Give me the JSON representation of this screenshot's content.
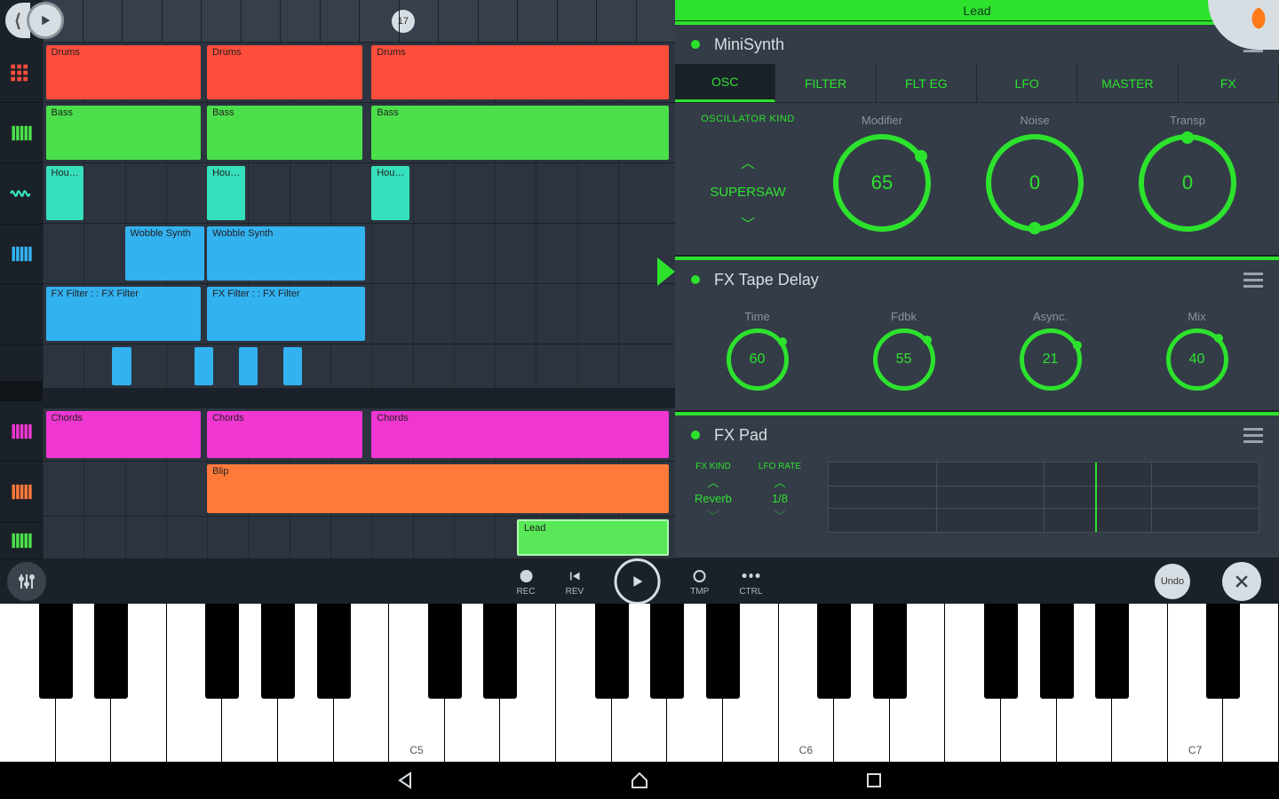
{
  "colors": {
    "accent_green": "#2de22d",
    "panel": "#343c48",
    "panel_dark": "#1b2129"
  },
  "playlist": {
    "playhead_bar": "17",
    "tracks": [
      {
        "color": "red",
        "icon": "pads",
        "clips": [
          "Drums",
          "Drums",
          "Drums"
        ]
      },
      {
        "color": "green",
        "icon": "piano",
        "clips": [
          "Bass",
          "Bass",
          "Bass"
        ]
      },
      {
        "color": "teal",
        "icon": "wave",
        "clips": [
          "Hou…",
          "Hou…",
          "Hou…"
        ]
      },
      {
        "color": "blue",
        "icon": "piano",
        "clips": [
          "Wobble Synth",
          "Wobble Synth"
        ]
      },
      {
        "color": "blue",
        "icon": "",
        "clips": [
          "FX Filter :  : FX Filter",
          "FX Filter :  : FX Filter"
        ]
      },
      {
        "color": "blue",
        "icon": "",
        "clips": [
          "",
          "",
          "",
          ""
        ]
      },
      {
        "color": "magenta",
        "icon": "piano",
        "clips": [
          "Chords",
          "Chords",
          "Chords"
        ]
      },
      {
        "color": "orange",
        "icon": "piano",
        "clips": [
          "Blip"
        ]
      },
      {
        "color": "green",
        "icon": "piano",
        "clips": [
          "Lead"
        ]
      }
    ]
  },
  "rack": {
    "title": "Lead",
    "modules": {
      "synth": {
        "name": "MiniSynth",
        "tabs": [
          "OSC",
          "FILTER",
          "FLT EG",
          "LFO",
          "MASTER",
          "FX"
        ],
        "active_tab": 0,
        "osc_kind_label": "OSCILLATOR KIND",
        "osc_kind_value": "SUPERSAW",
        "knobs": [
          {
            "label": "Modifier",
            "value": "65"
          },
          {
            "label": "Noise",
            "value": "0"
          },
          {
            "label": "Transp",
            "value": "0"
          }
        ]
      },
      "delay": {
        "name": "FX Tape Delay",
        "knobs": [
          {
            "label": "Time",
            "value": "60"
          },
          {
            "label": "Fdbk",
            "value": "55"
          },
          {
            "label": "Async.",
            "value": "21"
          },
          {
            "label": "Mix",
            "value": "40"
          }
        ]
      },
      "fxpad": {
        "name": "FX Pad",
        "fx_kind_label": "FX KIND",
        "fx_kind_value": "Reverb",
        "lfo_rate_label": "LFO RATE",
        "lfo_rate_value": "1/8"
      }
    }
  },
  "transport": {
    "rec": "REC",
    "rev": "REV",
    "tmp": "TMP",
    "ctrl": "CTRL",
    "undo": "Undo"
  },
  "piano": {
    "labels": {
      "7": "C5",
      "14": "C6",
      "21": "C7"
    }
  }
}
